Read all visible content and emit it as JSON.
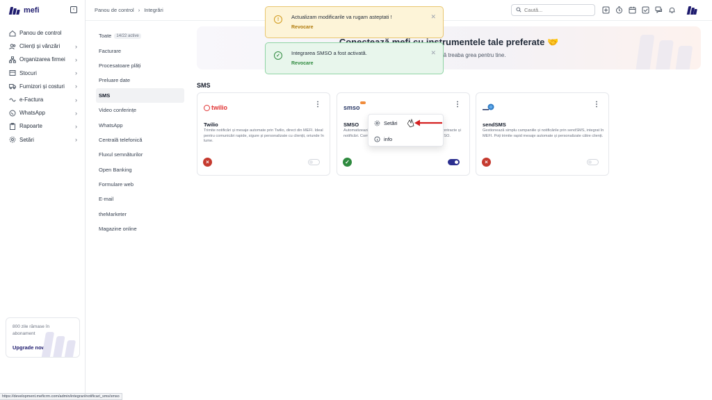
{
  "app": {
    "logo_text": "mefi"
  },
  "sidebar": {
    "items": [
      {
        "label": "Panou de control",
        "icon": "home-icon",
        "chevron": false
      },
      {
        "label": "Clienți și vânzări",
        "icon": "users-icon",
        "chevron": true
      },
      {
        "label": "Organizarea firmei",
        "icon": "sitemap-icon",
        "chevron": true
      },
      {
        "label": "Stocuri",
        "icon": "box-icon",
        "chevron": true
      },
      {
        "label": "Furnizori și costuri",
        "icon": "truck-icon",
        "chevron": true
      },
      {
        "label": "e-Factura",
        "icon": "efactura-icon",
        "chevron": true
      },
      {
        "label": "WhatsApp",
        "icon": "whatsapp-icon",
        "chevron": true
      },
      {
        "label": "Rapoarte",
        "icon": "clipboard-icon",
        "chevron": true
      },
      {
        "label": "Setări",
        "icon": "gear-icon",
        "chevron": true
      }
    ],
    "upgrade": {
      "days_text": "800 zile rămase în abonament",
      "link_label": "Upgrade now"
    }
  },
  "header": {
    "breadcrumb": [
      "Panou de control",
      "Integrări"
    ],
    "search_placeholder": "Caută..."
  },
  "subnav": {
    "items": [
      {
        "label": "Toate",
        "badge": "14/22 active"
      },
      {
        "label": "Facturare"
      },
      {
        "label": "Procesatoare plăți"
      },
      {
        "label": "Preluare date"
      },
      {
        "label": "SMS",
        "active": true
      },
      {
        "label": "Video conferințe"
      },
      {
        "label": "WhatsApp"
      },
      {
        "label": "Centrală telefonică"
      },
      {
        "label": "Fluxul semnăturilor"
      },
      {
        "label": "Open Banking"
      },
      {
        "label": "Formulare web"
      },
      {
        "label": "E-mail"
      },
      {
        "label": "theMarketer"
      },
      {
        "label": "Magazine online"
      }
    ]
  },
  "hero": {
    "title": "Conectează mefi cu instrumentele tale preferate 🤝",
    "subtitle": "Automatizările să facă treaba grea pentru tine."
  },
  "section": {
    "title": "SMS"
  },
  "cards": [
    {
      "logo_text": "twilio",
      "name": "Twilio",
      "description": "Trimite notificări și mesaje automate prin Twilio, direct din MEFI. Ideal pentru comunicări rapide, sigure și personalizate cu clienții, oriunde în lume.",
      "active": false
    },
    {
      "logo_text": "smso",
      "name": "SMSO",
      "description": "Automatizează trimiterea de SMS-uri către clienți pentru contracte și notificări. Comunicare rapidă și mesaje interactive prin SMSO.",
      "active": true
    },
    {
      "logo_text": "",
      "name": "sendSMS",
      "description": "Gestionează simplu campaniile și notificările prin sendSMS, integrat în MEFI. Poți trimite rapid mesaje automate și personalizate către clienți.",
      "active": false
    }
  ],
  "dropdown": {
    "items": [
      {
        "label": "Setări",
        "icon": "gear-icon"
      },
      {
        "label": "info",
        "icon": "info-icon"
      }
    ]
  },
  "toasts": [
    {
      "type": "warning",
      "message": "Actualizam modificarile va rugam asteptati !",
      "action": "Revocare",
      "icon_glyph": "!"
    },
    {
      "type": "success",
      "message": "Integrarea SMSO a fost activată.",
      "action": "Revocare",
      "icon_glyph": "✓"
    }
  ],
  "statusbar": {
    "url": "https://development.meficrm.com/admin/integrari/notificari_sms/smso"
  },
  "colors": {
    "brand": "#1e1b6e",
    "toggle_on": "#2b2f8f",
    "success": "#2f8a3f",
    "error": "#c53a2f",
    "warning": "#d19a1c"
  }
}
